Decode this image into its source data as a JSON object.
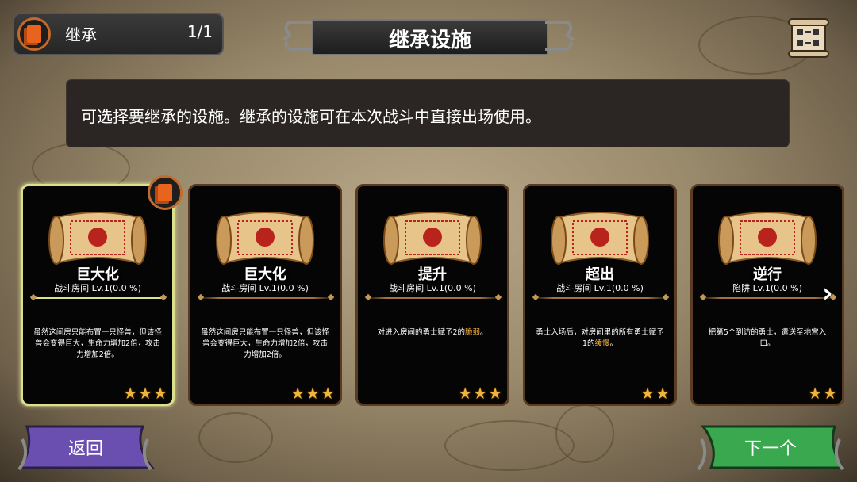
{
  "counter": {
    "label": "继承",
    "count": "1/1"
  },
  "title": "继承设施",
  "description": "可选择要继承的设施。继承的设施可在本次战斗中直接出场使用。",
  "cards": [
    {
      "name": "巨大化",
      "type": "战斗房间 Lv.1(0.0 %)",
      "effect_before": "虽然这间房只能布置一只怪兽，但该怪兽会变得巨大，生命力增加2倍，攻击力增加2倍。",
      "effect_hl": "",
      "effect_after": "",
      "stars": 3,
      "selected": true
    },
    {
      "name": "巨大化",
      "type": "战斗房间 Lv.1(0.0 %)",
      "effect_before": "虽然这间房只能布置一只怪兽，但该怪兽会变得巨大，生命力增加2倍，攻击力增加2倍。",
      "effect_hl": "",
      "effect_after": "",
      "stars": 3,
      "selected": false
    },
    {
      "name": "提升",
      "type": "战斗房间 Lv.1(0.0 %)",
      "effect_before": "对进入房间的勇士赋予2的",
      "effect_hl": "脆弱",
      "effect_after": "。",
      "stars": 3,
      "selected": false
    },
    {
      "name": "超出",
      "type": "战斗房间 Lv.1(0.0 %)",
      "effect_before": "勇士入场后，对房间里的所有勇士赋予1的",
      "effect_hl": "缓慢",
      "effect_after": "。",
      "stars": 2,
      "selected": false
    },
    {
      "name": "逆行",
      "type": "陷阱 Lv.1(0.0 %)",
      "effect_before": "把第5个到访的勇士，遣送至地宫入口。",
      "effect_hl": "",
      "effect_after": "",
      "stars": 2,
      "selected": false
    }
  ],
  "buttons": {
    "back": "返回",
    "next": "下一个"
  },
  "icons": {
    "counter": "book-icon",
    "top_right": "scroll-map-icon",
    "arrow": "chevron-right-icon",
    "star": "star-icon"
  },
  "colors": {
    "star": "#f1b43a",
    "highlight": "#f3b13a",
    "back_button": "#6b4fb0",
    "next_button": "#3aa84f",
    "selected_border": "#dbe08c"
  }
}
